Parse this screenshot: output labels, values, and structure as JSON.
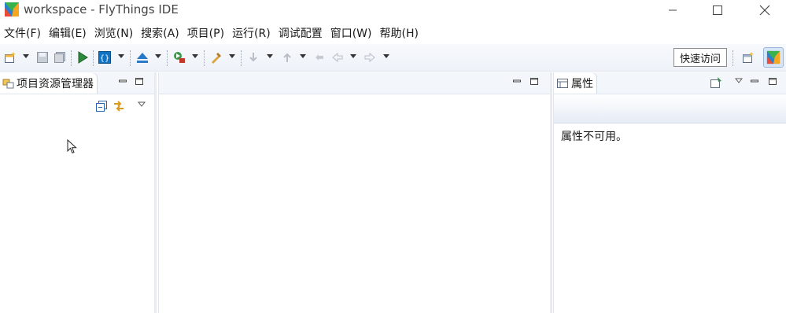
{
  "window": {
    "title": "workspace - FlyThings IDE",
    "controls": [
      "minimize-icon",
      "maximize-icon",
      "close-icon"
    ]
  },
  "menu": [
    {
      "label": "文件(F)"
    },
    {
      "label": "编辑(E)"
    },
    {
      "label": "浏览(N)"
    },
    {
      "label": "搜索(A)"
    },
    {
      "label": "项目(P)"
    },
    {
      "label": "运行(R)"
    },
    {
      "label": "调试配置"
    },
    {
      "label": "窗口(W)"
    },
    {
      "label": "帮助(H)"
    }
  ],
  "toolbar": {
    "quick_access_label": "快速访问",
    "icons": [
      "new-icon",
      "save-icon",
      "save-all-icon",
      "run-icon",
      "debug-config-icon",
      "build-icon",
      "external-tools-icon",
      "tools-icon",
      "next-annotation-icon",
      "prev-annotation-icon",
      "last-edit-icon",
      "back-icon",
      "forward-icon",
      "open-perspective-icon",
      "flythings-perspective-icon"
    ]
  },
  "left_panel": {
    "tab_label": "项目资源管理器",
    "icons": [
      "collapse-all-icon",
      "link-editor-icon",
      "view-menu-icon"
    ]
  },
  "right_panel": {
    "tab_label": "属性",
    "message": "属性不可用。"
  },
  "colors": {
    "accent": "#0f72c2",
    "toolbar_bg": "#eef2f8",
    "tab_strip": "#f3f6fa"
  }
}
